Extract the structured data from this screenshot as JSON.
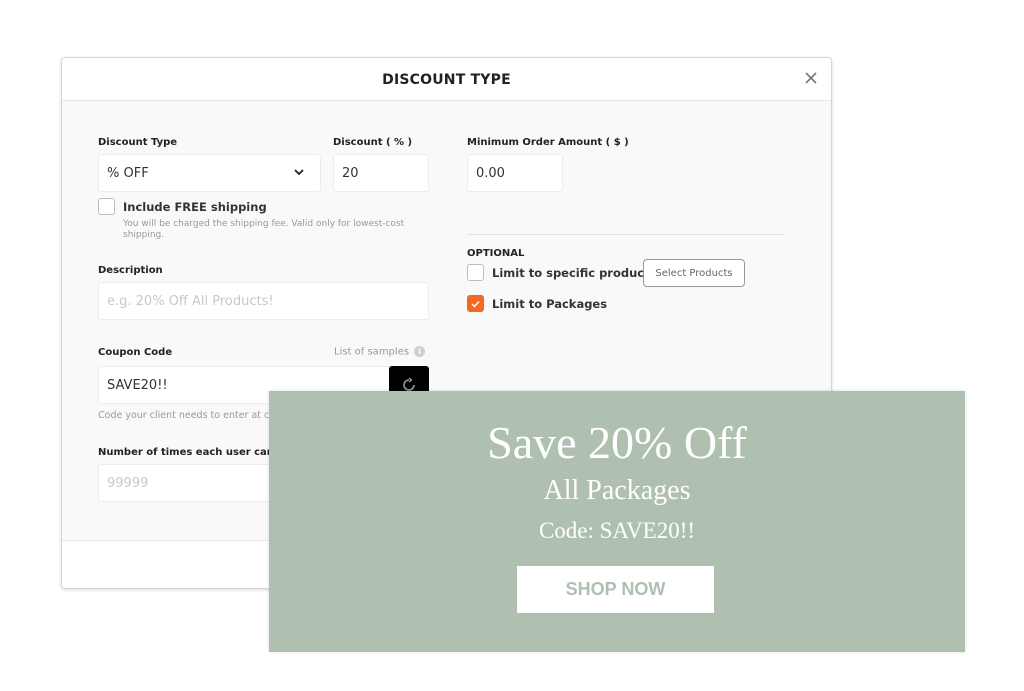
{
  "modal": {
    "title": "DISCOUNT TYPE",
    "close_icon": "close-icon",
    "discount_type": {
      "label": "Discount Type",
      "value": "% OFF"
    },
    "discount": {
      "label": "Discount ( % )",
      "value": "20"
    },
    "min_order": {
      "label": "Minimum Order Amount ( $ )",
      "value": "0.00"
    },
    "free_shipping": {
      "label": "Include FREE shipping",
      "checked": false,
      "hint_line1": "You will be charged the shipping fee. Valid only for lowest-cost",
      "hint_line2": "shipping."
    },
    "description": {
      "label": "Description",
      "placeholder": "e.g. 20% Off All Products!"
    },
    "coupon_code": {
      "label": "Coupon Code",
      "samples_link": "List of samples",
      "value": "SAVE20!!",
      "hint": "Code your client needs to enter at c"
    },
    "uses_per_user": {
      "label": "Number of times each user can use",
      "placeholder": "99999"
    },
    "optional": {
      "heading": "OPTIONAL",
      "limit_products": {
        "label": "Limit to specific products",
        "checked": false
      },
      "select_products_button": "Select Products",
      "limit_packages": {
        "label": "Limit to Packages",
        "checked": true
      }
    },
    "accent_color": "#f26a21"
  },
  "banner": {
    "title": "Save 20% Off",
    "subtitle": "All Packages",
    "code_line": "Code: SAVE20!!",
    "cta": "SHOP NOW",
    "background_color": "#afc0b1"
  }
}
